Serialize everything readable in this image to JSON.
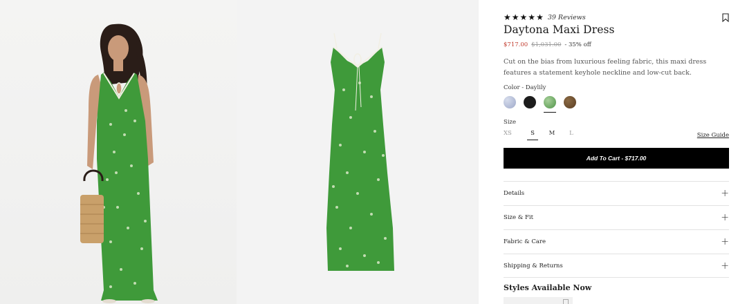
{
  "product": {
    "rating_stars": 5,
    "review_count_label": "39 Reviews",
    "title": "Daytona Maxi Dress",
    "price_sale": "$717.00",
    "price_original": "$1,031.00",
    "discount": "- 35% off",
    "description": "Cut on the bias from luxurious feeling fabric, this maxi dress features a statement keyhole neckline and low-cut back."
  },
  "color": {
    "label": "Color - Daylily",
    "swatches": [
      {
        "name": "light-blue-floral",
        "hex": "#b7bfd8"
      },
      {
        "name": "black",
        "hex": "#1c1c1c"
      },
      {
        "name": "green-floral",
        "hex": "#6fa866",
        "selected": true
      },
      {
        "name": "brown",
        "hex": "#6b4a2a"
      }
    ]
  },
  "size": {
    "label": "Size",
    "options": [
      "XS",
      "S",
      "M",
      "L"
    ],
    "selected": "S",
    "guide_label": "Size Guide"
  },
  "cart": {
    "button_label": "Add To Cart - $717.00"
  },
  "accordion": {
    "items": [
      "Details",
      "Size & Fit",
      "Fabric & Care",
      "Shipping & Returns"
    ]
  },
  "styles": {
    "title": "Styles Available Now"
  },
  "colors": {
    "dress_green": "#3f9a3a",
    "sale_red": "#c0392b",
    "button_black": "#000000"
  },
  "icons": {
    "star": "star-icon",
    "bookmark": "bookmark-icon",
    "plus": "plus-icon"
  }
}
